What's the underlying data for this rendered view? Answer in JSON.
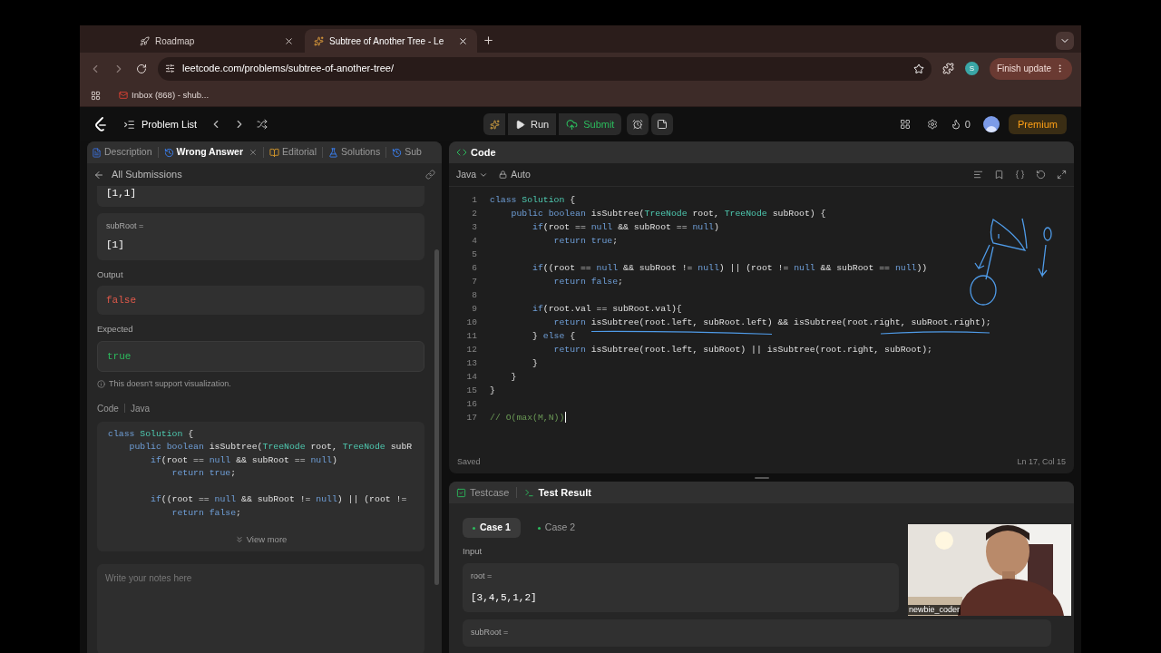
{
  "browser": {
    "tabs": [
      {
        "title": "Roadmap",
        "selected": false
      },
      {
        "title": "Subtree of Another Tree - Le",
        "selected": true
      }
    ],
    "url": "leetcode.com/problems/subtree-of-another-tree/",
    "profile": "S",
    "update_button": "Finish update",
    "bookmarks": [
      "Inbox (868) - shub..."
    ]
  },
  "nav": {
    "problem_list": "Problem List",
    "run": "Run",
    "submit": "Submit",
    "streak": "0",
    "premium": "Premium"
  },
  "left_panel": {
    "tabs": [
      {
        "label": "Description",
        "selected": false
      },
      {
        "label": "Wrong Answer",
        "selected": true
      },
      {
        "label": "Editorial",
        "selected": false
      },
      {
        "label": "Solutions",
        "selected": false
      },
      {
        "label": "Sub",
        "selected": false
      }
    ],
    "back_link": "All Submissions",
    "inputs": [
      {
        "value": "[1,1]"
      },
      {
        "name": "subRoot =",
        "value": "[1]"
      }
    ],
    "output_label": "Output",
    "output": "false",
    "expected_label": "Expected",
    "expected": "true",
    "notice": "This doesn't support visualization.",
    "code_label": "Code",
    "language": "Java",
    "code": [
      {
        "kind": "code",
        "tokens": [
          {
            "text": "class ",
            "kind": "keyword"
          },
          {
            "text": "Solution",
            "kind": "type"
          },
          {
            "text": " {",
            "kind": "plain"
          }
        ]
      },
      {
        "kind": "code",
        "tokens": [
          {
            "text": "    public boolean ",
            "kind": "keyword"
          },
          {
            "text": "isSubtree(",
            "kind": "plain"
          },
          {
            "text": "TreeNode",
            "kind": "type"
          },
          {
            "text": " root, ",
            "kind": "plain"
          },
          {
            "text": "TreeNode",
            "kind": "type"
          },
          {
            "text": " subR",
            "kind": "plain"
          }
        ]
      },
      {
        "kind": "code",
        "tokens": [
          {
            "text": "        if",
            "kind": "keyword"
          },
          {
            "text": "(root == ",
            "kind": "plain"
          },
          {
            "text": "null",
            "kind": "keyword"
          },
          {
            "text": " && subRoot == ",
            "kind": "plain"
          },
          {
            "text": "null",
            "kind": "keyword"
          },
          {
            "text": ")",
            "kind": "plain"
          }
        ]
      },
      {
        "kind": "code",
        "tokens": [
          {
            "text": "            return ",
            "kind": "keyword"
          },
          {
            "text": "true",
            "kind": "keyword"
          },
          {
            "text": ";",
            "kind": "plain"
          }
        ]
      },
      {
        "kind": "blank"
      },
      {
        "kind": "code",
        "tokens": [
          {
            "text": "        if",
            "kind": "keyword"
          },
          {
            "text": "((root == ",
            "kind": "plain"
          },
          {
            "text": "null",
            "kind": "keyword"
          },
          {
            "text": " && subRoot != ",
            "kind": "plain"
          },
          {
            "text": "null",
            "kind": "keyword"
          },
          {
            "text": ") || (root !=",
            "kind": "plain"
          }
        ]
      },
      {
        "kind": "code",
        "tokens": [
          {
            "text": "            return ",
            "kind": "keyword"
          },
          {
            "text": "false",
            "kind": "keyword"
          },
          {
            "text": ";",
            "kind": "plain"
          }
        ]
      }
    ],
    "view_more": "View more",
    "notes_placeholder": "Write your notes here"
  },
  "editor": {
    "title": "Code",
    "language": "Java",
    "mode": "Auto",
    "lines": [
      {
        "number": "1",
        "tokens": [
          {
            "text": "class ",
            "kind": "keyword"
          },
          {
            "text": "Solution",
            "kind": "type"
          },
          {
            "text": " {",
            "kind": "plain"
          }
        ]
      },
      {
        "number": "2",
        "tokens": [
          {
            "text": "    public boolean ",
            "kind": "keyword"
          },
          {
            "text": "isSubtree(",
            "kind": "plain"
          },
          {
            "text": "TreeNode",
            "kind": "type"
          },
          {
            "text": " root, ",
            "kind": "plain"
          },
          {
            "text": "TreeNode",
            "kind": "type"
          },
          {
            "text": " subRoot) {",
            "kind": "plain"
          }
        ]
      },
      {
        "number": "3",
        "tokens": [
          {
            "text": "        if",
            "kind": "keyword"
          },
          {
            "text": "(root == ",
            "kind": "plain"
          },
          {
            "text": "null",
            "kind": "keyword"
          },
          {
            "text": " && subRoot == ",
            "kind": "plain"
          },
          {
            "text": "null",
            "kind": "keyword"
          },
          {
            "text": ")",
            "kind": "plain"
          }
        ]
      },
      {
        "number": "4",
        "tokens": [
          {
            "text": "            return ",
            "kind": "keyword"
          },
          {
            "text": "true",
            "kind": "keyword"
          },
          {
            "text": ";",
            "kind": "plain"
          }
        ]
      },
      {
        "number": "5"
      },
      {
        "number": "6",
        "tokens": [
          {
            "text": "        if",
            "kind": "keyword"
          },
          {
            "text": "((root == ",
            "kind": "plain"
          },
          {
            "text": "null",
            "kind": "keyword"
          },
          {
            "text": " && subRoot != ",
            "kind": "plain"
          },
          {
            "text": "null",
            "kind": "keyword"
          },
          {
            "text": ") || (root != ",
            "kind": "plain"
          },
          {
            "text": "null",
            "kind": "keyword"
          },
          {
            "text": " && subRoot == ",
            "kind": "plain"
          },
          {
            "text": "null",
            "kind": "keyword"
          },
          {
            "text": "))",
            "kind": "plain"
          }
        ]
      },
      {
        "number": "7",
        "tokens": [
          {
            "text": "            return ",
            "kind": "keyword"
          },
          {
            "text": "false",
            "kind": "keyword"
          },
          {
            "text": ";",
            "kind": "plain"
          }
        ]
      },
      {
        "number": "8"
      },
      {
        "number": "9",
        "tokens": [
          {
            "text": "        if",
            "kind": "keyword"
          },
          {
            "text": "(root.val == subRoot.val){",
            "kind": "plain"
          }
        ]
      },
      {
        "number": "10",
        "tokens": [
          {
            "text": "            return ",
            "kind": "keyword"
          },
          {
            "text": "isSubtree(root.left, subRoot.left) && isSubtree(root.right, subRoot.right);",
            "kind": "plain"
          }
        ]
      },
      {
        "number": "11",
        "tokens": [
          {
            "text": "        } ",
            "kind": "plain"
          },
          {
            "text": "else",
            "kind": "keyword"
          },
          {
            "text": " {",
            "kind": "plain"
          }
        ]
      },
      {
        "number": "12",
        "tokens": [
          {
            "text": "            return ",
            "kind": "keyword"
          },
          {
            "text": "isSubtree(root.left, subRoot) || isSubtree(root.right, subRoot);",
            "kind": "plain"
          }
        ]
      },
      {
        "number": "13",
        "tokens": [
          {
            "text": "        }",
            "kind": "plain"
          }
        ]
      },
      {
        "number": "14",
        "tokens": [
          {
            "text": "    }",
            "kind": "plain"
          }
        ]
      },
      {
        "number": "15",
        "tokens": [
          {
            "text": "}",
            "kind": "plain"
          }
        ]
      },
      {
        "number": "16"
      },
      {
        "number": "17",
        "tokens": [
          {
            "text": "// O(max(M,N))",
            "kind": "comment"
          }
        ]
      }
    ],
    "status": "Saved",
    "cursor": "Ln 17, Col 15"
  },
  "test_panel": {
    "tabs": [
      {
        "label": "Testcase",
        "selected": false
      },
      {
        "label": "Test Result",
        "selected": true
      }
    ],
    "cases": [
      {
        "label": "Case 1",
        "selected": true
      },
      {
        "label": "Case 2",
        "selected": false
      }
    ],
    "input_label": "Input",
    "inputs": [
      {
        "name": "root =",
        "value": "[3,4,5,1,2]"
      },
      {
        "name": "subRoot ="
      }
    ]
  },
  "webcam": {
    "kind": "picture",
    "name": "newbie_coder"
  }
}
